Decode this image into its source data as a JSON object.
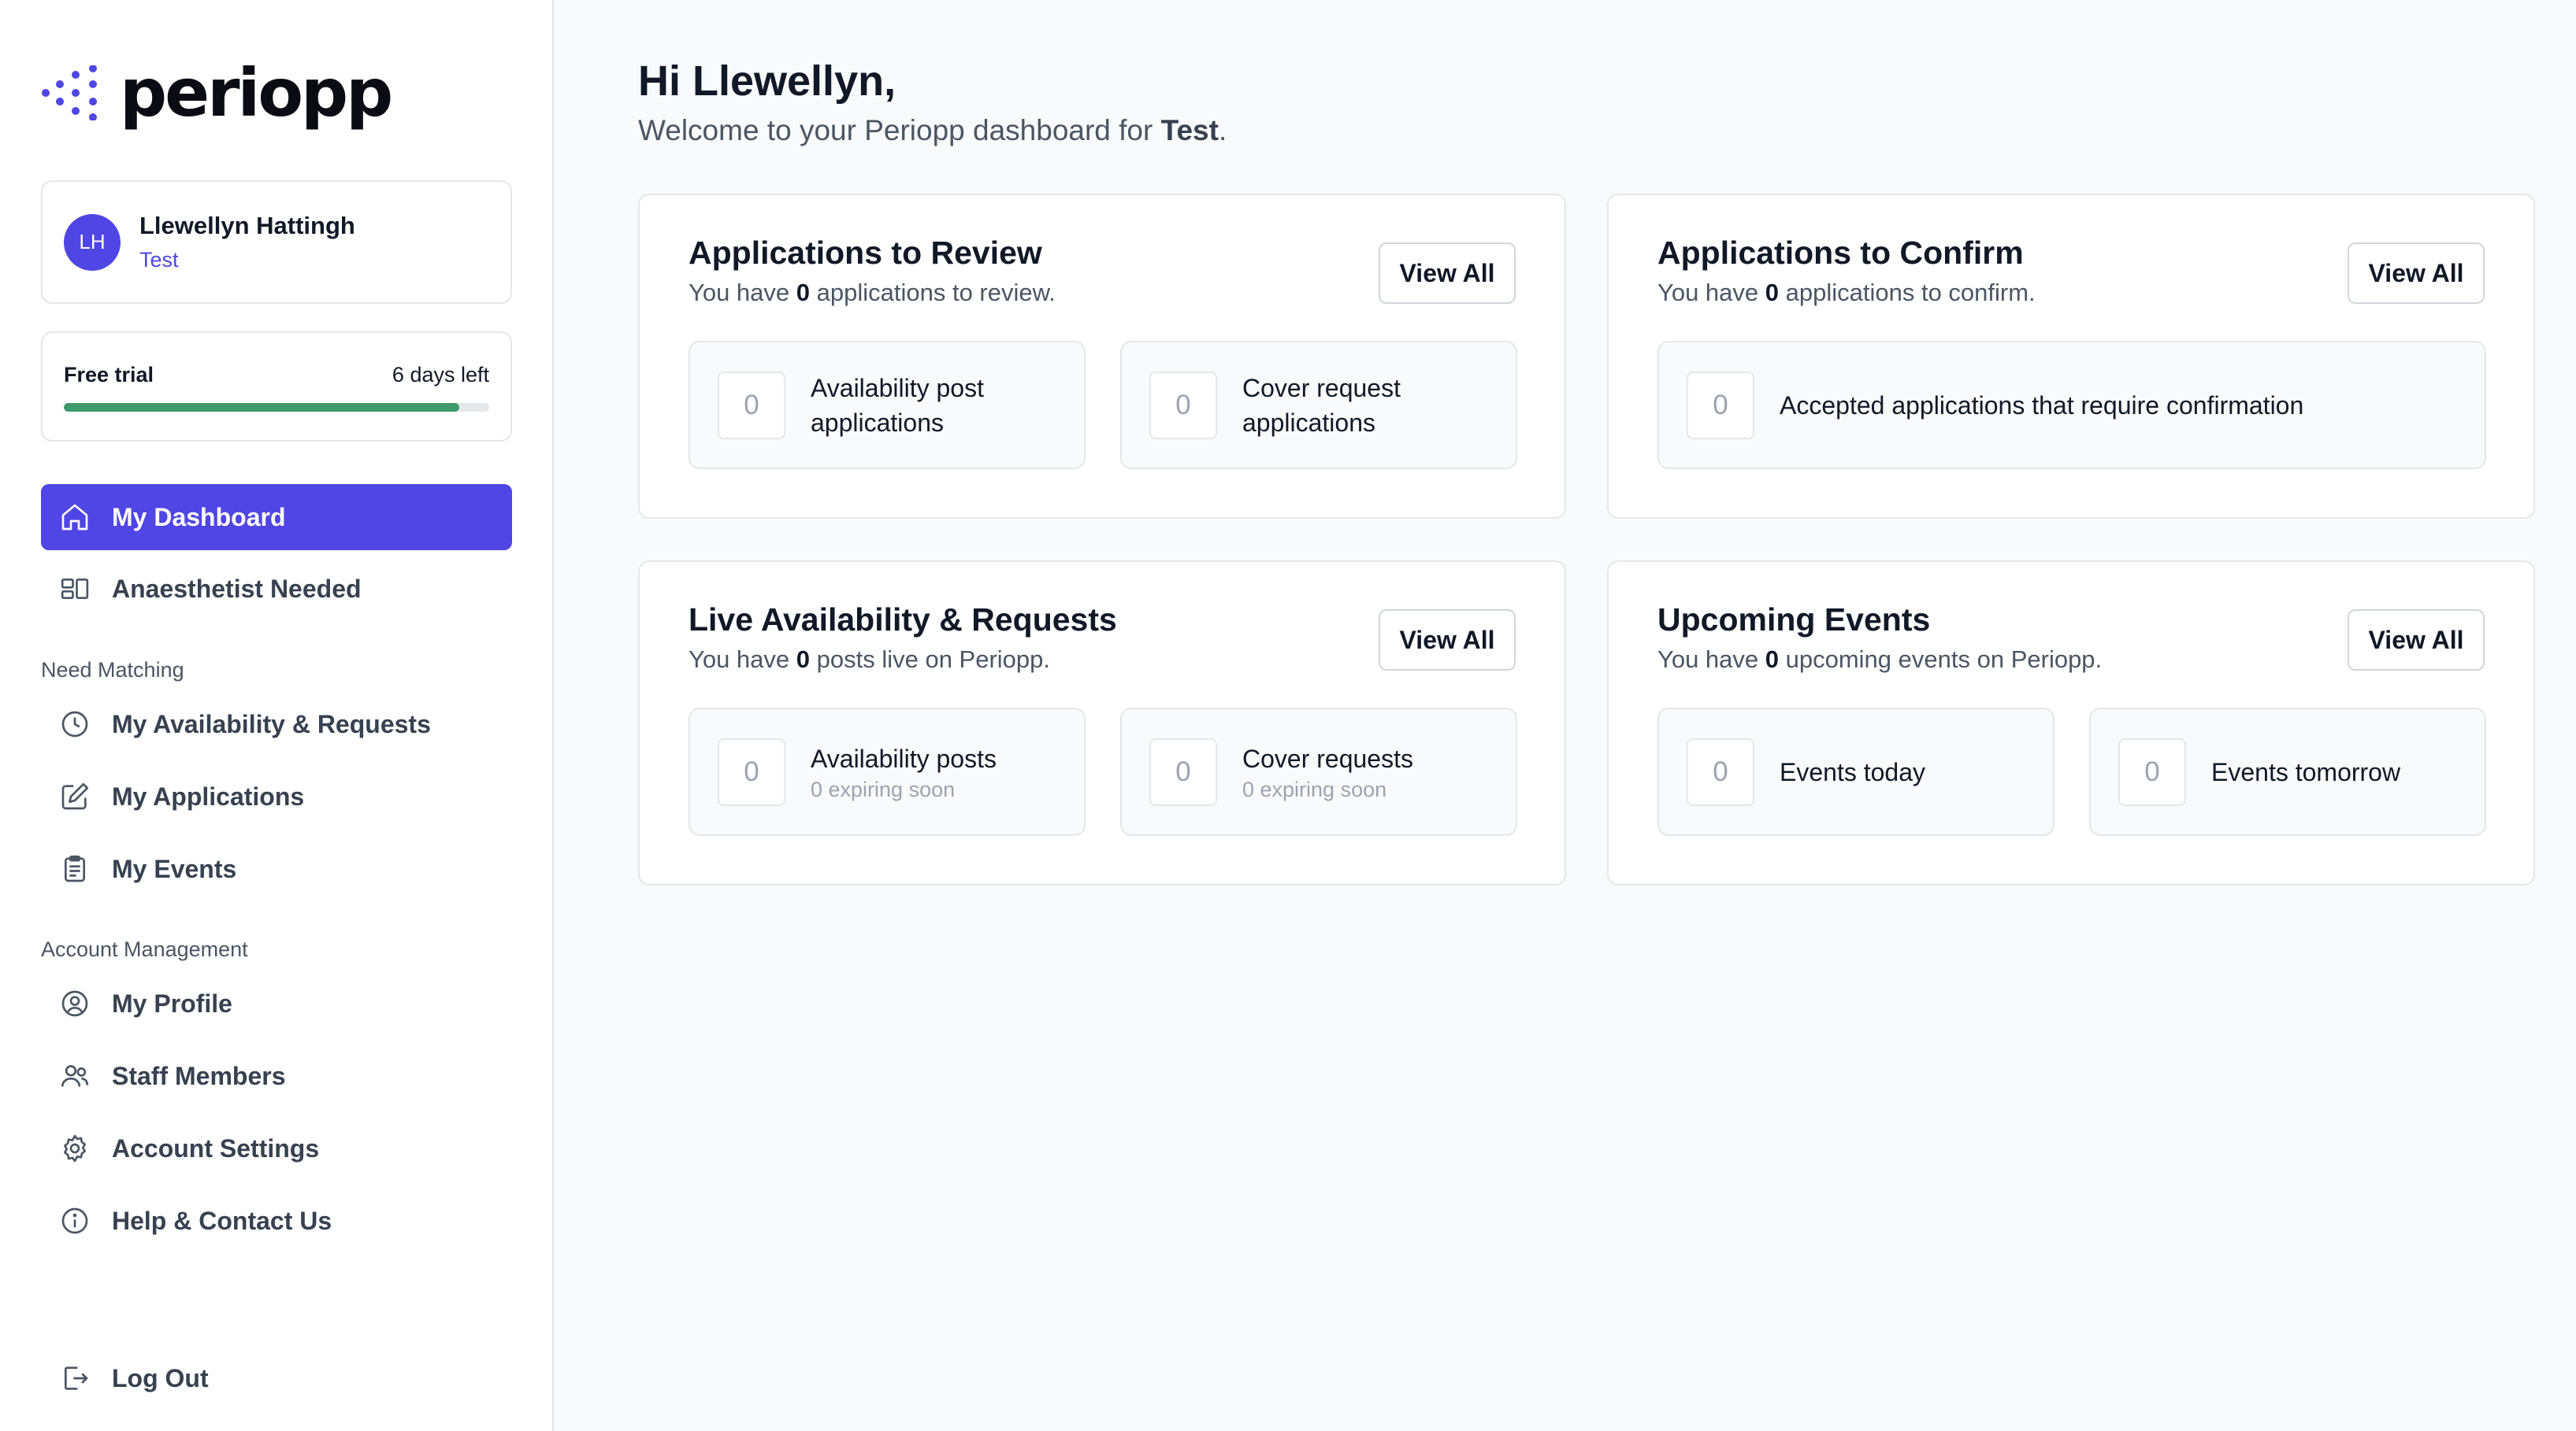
{
  "brand": {
    "logo_text": "periopp"
  },
  "user": {
    "initials": "LH",
    "name": "Llewellyn Hattingh",
    "org": "Test"
  },
  "trial": {
    "label": "Free trial",
    "days_left": "6 days left",
    "progress_fraction": 0.93
  },
  "nav": {
    "dashboard": "My Dashboard",
    "anaesthetist_needed": "Anaesthetist Needed",
    "section_matching": "Need Matching",
    "availability": "My Availability & Requests",
    "applications": "My Applications",
    "events": "My Events",
    "section_account": "Account Management",
    "profile": "My Profile",
    "staff": "Staff Members",
    "settings": "Account Settings",
    "help": "Help & Contact Us",
    "logout": "Log Out"
  },
  "header": {
    "greeting": "Hi Llewellyn,",
    "welcome_prefix": "Welcome to your Periopp dashboard for ",
    "welcome_org": "Test",
    "welcome_suffix": "."
  },
  "cards": {
    "review": {
      "title": "Applications to Review",
      "sub_prefix": "You have ",
      "count": "0",
      "sub_suffix": " applications to review.",
      "button": "View All",
      "stats": [
        {
          "value": "0",
          "label": "Availability post applications"
        },
        {
          "value": "0",
          "label": "Cover request applications"
        }
      ]
    },
    "confirm": {
      "title": "Applications to Confirm",
      "sub_prefix": "You have ",
      "count": "0",
      "sub_suffix": " applications to confirm.",
      "button": "View All",
      "stats": [
        {
          "value": "0",
          "label": "Accepted applications that require confirmation"
        }
      ]
    },
    "live": {
      "title": "Live Availability & Requests",
      "sub_prefix": "You have ",
      "count": "0",
      "sub_suffix": " posts live on Periopp.",
      "button": "View All",
      "stats": [
        {
          "value": "0",
          "label": "Availability posts",
          "sub": "0 expiring soon"
        },
        {
          "value": "0",
          "label": "Cover requests",
          "sub": "0 expiring soon"
        }
      ]
    },
    "events": {
      "title": "Upcoming Events",
      "sub_prefix": "You have ",
      "count": "0",
      "sub_suffix": " upcoming events on Periopp.",
      "button": "View All",
      "stats": [
        {
          "value": "0",
          "label": "Events today"
        },
        {
          "value": "0",
          "label": "Events tomorrow"
        }
      ]
    }
  },
  "colors": {
    "accent": "#4f46e5",
    "progress": "#3f9a6b",
    "background": "#f9fafb"
  }
}
